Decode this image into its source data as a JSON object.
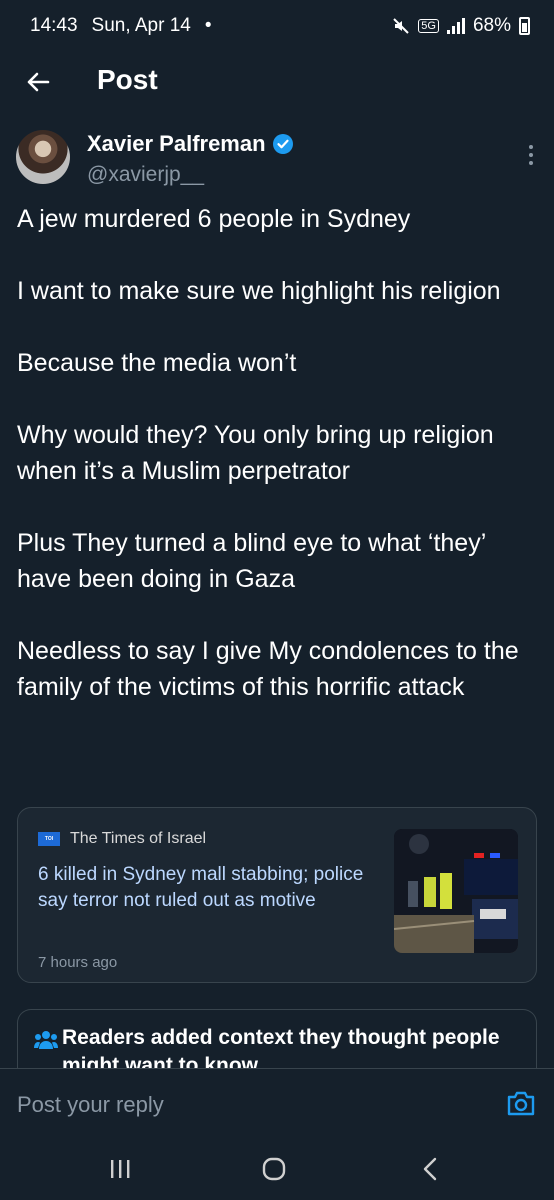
{
  "status_bar": {
    "time": "14:43",
    "date": "Sun, Apr 14",
    "dot": "•",
    "network": "5G",
    "battery": "68%"
  },
  "header": {
    "title": "Post"
  },
  "author": {
    "name": "Xavier Palfreman",
    "handle": "@xavierjp__",
    "verified_color": "#1d9bf0"
  },
  "tweet": {
    "paragraphs": [
      "A jew murdered 6 people in Sydney",
      "I want to make sure we highlight his religion",
      "Because the media won’t",
      "Why would they? You only bring up religion when it’s a Muslim perpetrator",
      "Plus They turned a blind eye to what ‘they’ have been doing in Gaza",
      "Needless to say I give My condolences to the family of the victims of this horrific attack"
    ]
  },
  "card": {
    "source": "The Times of Israel",
    "headline": "6 killed in Sydney mall stabbing; police say terror not ruled out as motive",
    "time": "7 hours ago"
  },
  "context": {
    "text": "Readers added context they thought people might want to know"
  },
  "reply": {
    "placeholder": "Post your reply"
  },
  "colors": {
    "background": "#15202b",
    "accent": "#1d9bf0",
    "secondary_text": "#8b98a5",
    "link_text": "#bcd8ff"
  }
}
